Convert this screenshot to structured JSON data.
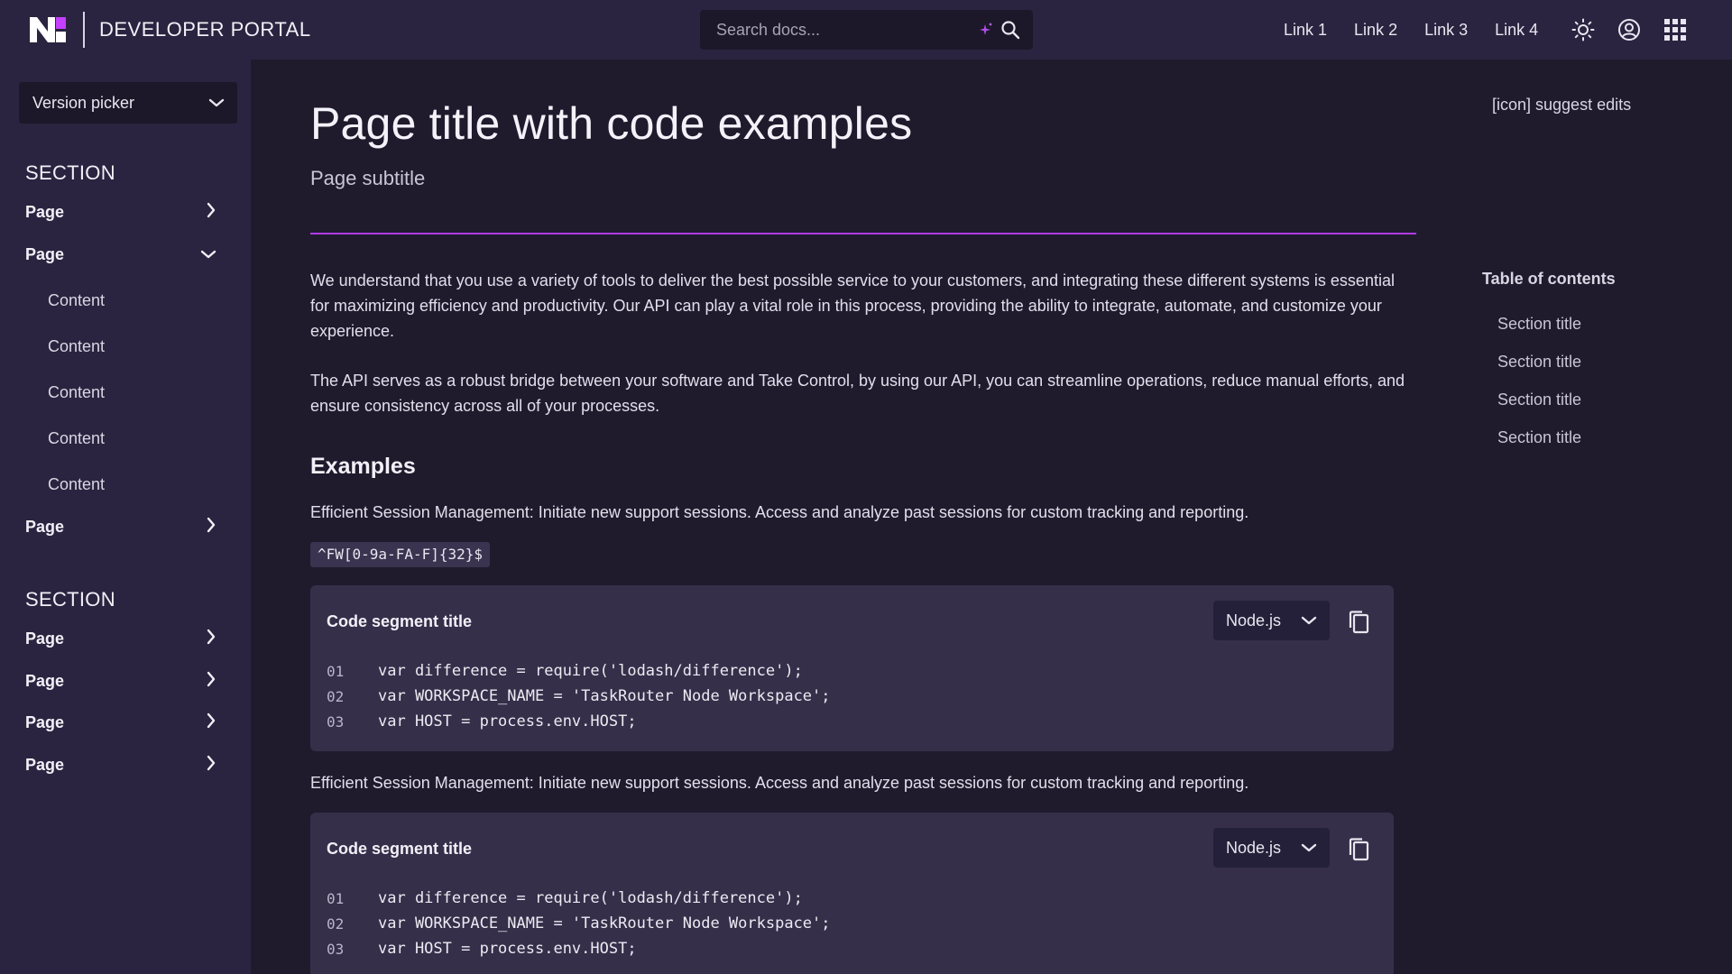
{
  "header": {
    "brand_name": "DEVELOPER PORTAL",
    "search": {
      "placeholder": "Search docs..."
    },
    "links": [
      "Link 1",
      "Link 2",
      "Link 3",
      "Link 4"
    ],
    "icons": [
      "sun-icon",
      "user-account-icon",
      "apps-grid-icon"
    ]
  },
  "sidebar": {
    "version_picker": "Version picker",
    "sections": [
      {
        "title": "SECTION",
        "items": [
          {
            "label": "Page",
            "state": "collapsed"
          },
          {
            "label": "Page",
            "state": "expanded",
            "children": [
              "Content",
              "Content",
              "Content",
              "Content",
              "Content"
            ]
          },
          {
            "label": "Page",
            "state": "collapsed"
          }
        ]
      },
      {
        "title": "SECTION",
        "items": [
          {
            "label": "Page",
            "state": "collapsed"
          },
          {
            "label": "Page",
            "state": "collapsed"
          },
          {
            "label": "Page",
            "state": "collapsed"
          },
          {
            "label": "Page",
            "state": "collapsed"
          }
        ]
      }
    ]
  },
  "main": {
    "title": "Page title with code examples",
    "subtitle": "Page subtitle",
    "suggest_edits": "[icon] suggest edits",
    "paragraphs": [
      "We understand that you use a variety of tools to deliver the best possible service to your customers, and integrating these different systems is essential for maximizing efficiency and productivity. Our API can play a vital role in this process, providing the ability to integrate, automate, and customize your experience.",
      "The API serves as a robust bridge between your software and Take Control, by using our API, you can streamline operations, reduce manual efforts, and ensure consistency across all of your processes."
    ],
    "examples_heading": "Examples",
    "example_text_1": "Efficient Session Management: Initiate new support sessions. Access and analyze past sessions for custom tracking and reporting.",
    "inline_code": "^FW[0-9a-FA-F]{32}$",
    "example_text_2": "Efficient Session Management: Initiate new support sessions. Access and analyze past sessions for custom tracking and reporting.",
    "code_blocks": [
      {
        "title": "Code segment title",
        "language": "Node.js",
        "lines": [
          {
            "num": "01",
            "code": "var difference = require('lodash/difference');"
          },
          {
            "num": "02",
            "code": "var WORKSPACE_NAME = 'TaskRouter Node Workspace';"
          },
          {
            "num": "03",
            "code": "var HOST = process.env.HOST;"
          }
        ]
      },
      {
        "title": "Code segment title",
        "language": "Node.js",
        "lines": [
          {
            "num": "01",
            "code": "var difference = require('lodash/difference');"
          },
          {
            "num": "02",
            "code": "var WORKSPACE_NAME = 'TaskRouter Node Workspace';"
          },
          {
            "num": "03",
            "code": "var HOST = process.env.HOST;"
          }
        ]
      }
    ]
  },
  "toc": {
    "title": "Table of contents",
    "items": [
      "Section title",
      "Section title",
      "Section title",
      "Section title"
    ]
  },
  "colors": {
    "background": "#1f1b2d",
    "panel": "#2a2440",
    "code_bg": "#352f4a",
    "accent": "#b23be8"
  }
}
